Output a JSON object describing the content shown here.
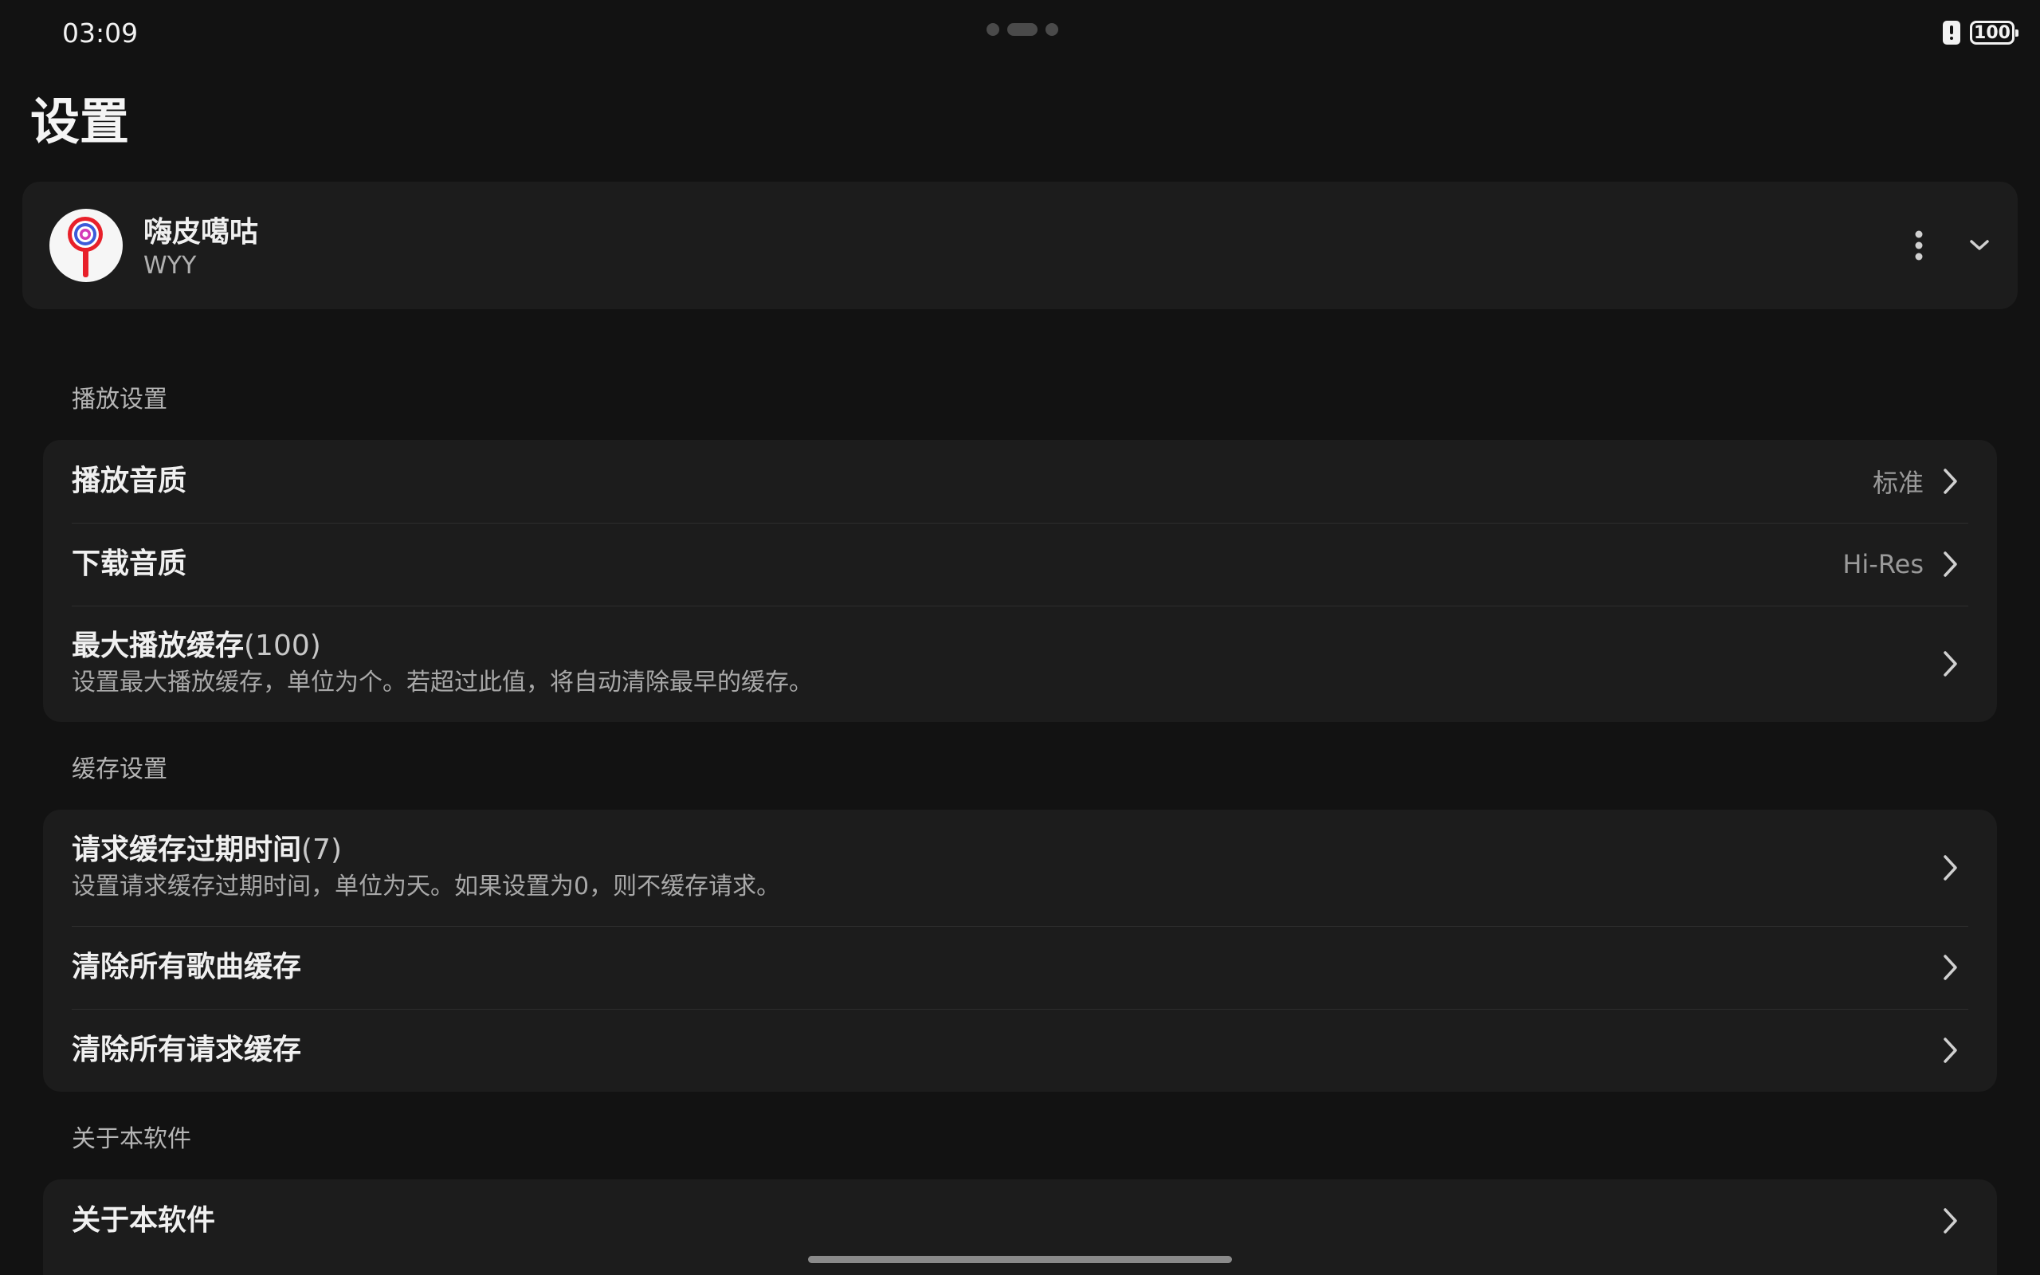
{
  "status_bar": {
    "time": "03:09",
    "battery": "100"
  },
  "page": {
    "title": "设置"
  },
  "account": {
    "name": "嗨皮噶咕",
    "id": "WYY"
  },
  "sections": {
    "playback": {
      "label": "播放设置",
      "items": [
        {
          "title": "播放音质",
          "value": "标准"
        },
        {
          "title": "下载音质",
          "value": "Hi-Res"
        },
        {
          "title": "最大播放缓存",
          "param": "(100)",
          "desc": "设置最大播放缓存，单位为个。若超过此值，将自动清除最早的缓存。"
        }
      ]
    },
    "cache": {
      "label": "缓存设置",
      "items": [
        {
          "title": "请求缓存过期时间",
          "param": "(7)",
          "desc": "设置请求缓存过期时间，单位为天。如果设置为0，则不缓存请求。"
        },
        {
          "title": "清除所有歌曲缓存"
        },
        {
          "title": "清除所有请求缓存"
        }
      ]
    },
    "about": {
      "label": "关于本软件",
      "items": [
        {
          "title": "关于本软件"
        }
      ]
    }
  }
}
